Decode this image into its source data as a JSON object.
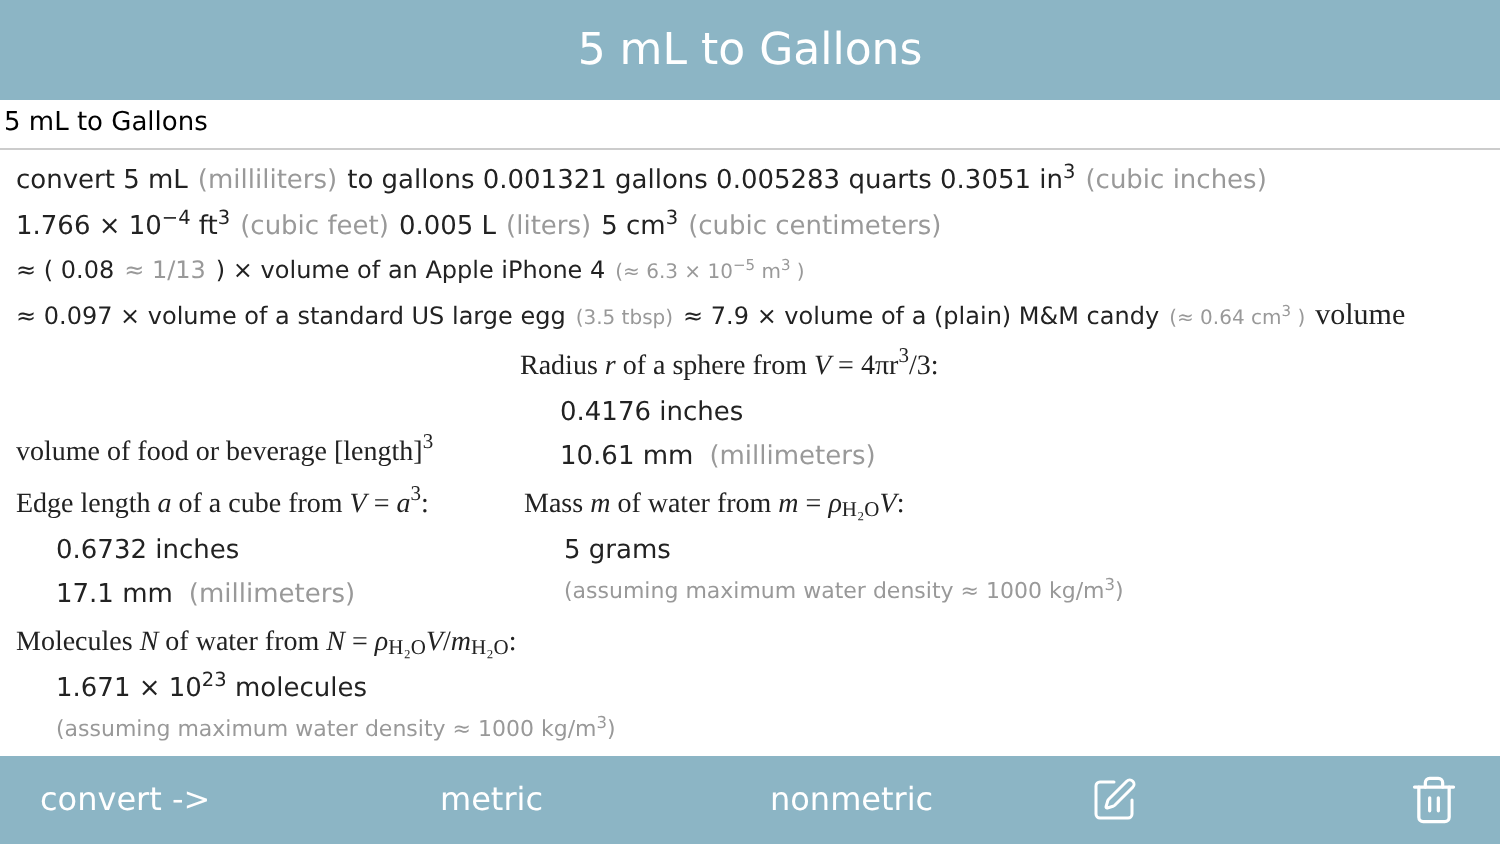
{
  "title": "5 mL to Gallons",
  "query": "5 mL to Gallons",
  "lines": [
    {
      "kind": "large",
      "segments": [
        {
          "kind": "value",
          "text": "convert 5 mL"
        },
        {
          "kind": "note",
          "text": "(milliliters)"
        },
        {
          "kind": "value",
          "text": "to gallons 0.001321 gallons 0.005283 quarts 0.3051 in$^{3}$"
        },
        {
          "kind": "note",
          "text": "(cubic inches)"
        }
      ]
    },
    {
      "kind": "large",
      "segments": [
        {
          "kind": "value",
          "text": "1.766 × 10$^{−4}$ ft$^{3}$"
        },
        {
          "kind": "note",
          "text": "(cubic feet)"
        },
        {
          "kind": "value",
          "text": "0.005 L"
        },
        {
          "kind": "note",
          "text": "(liters)"
        },
        {
          "kind": "value",
          "text": "5 cm$^{3}$"
        },
        {
          "kind": "note",
          "text": "(cubic centimeters)"
        }
      ]
    },
    {
      "kind": "small",
      "segments": [
        {
          "kind": "value",
          "text": "≈ ( 0.08"
        },
        {
          "kind": "note",
          "text": "≈ 1/13"
        },
        {
          "kind": "value",
          "text": ") × volume of an Apple iPhone 4"
        },
        {
          "kind": "tiny",
          "text": "(≈ 6.3 × 10$^{−5}$ m$^{3}$ )"
        }
      ]
    },
    {
      "kind": "small",
      "segments": [
        {
          "kind": "value",
          "text": "≈ 0.097 × volume of a standard US large egg"
        },
        {
          "kind": "tiny",
          "text": "(3.5 tbsp)"
        },
        {
          "kind": "value",
          "text": "≈ 7.9 × volume of a (plain) M&M candy"
        },
        {
          "kind": "tiny",
          "text": "(≈ 0.64 cm$^{3}$ )"
        },
        {
          "kind": "math",
          "text": "volume"
        }
      ]
    }
  ],
  "food_label": "volume of food or beverage [length]$^{3}$",
  "radius": {
    "heading": "Radius *r* of a sphere from *V* = 4πr$^{3}$/3:",
    "values": [
      {
        "value": "0.4176 inches"
      },
      {
        "value": "10.61 mm",
        "note": "(millimeters)"
      }
    ]
  },
  "edge": {
    "heading": "Edge length *a* of a cube from *V* = *a*$^{3}$:",
    "values": [
      {
        "value": "0.6732 inches"
      },
      {
        "value": "17.1 mm",
        "note": "(millimeters)"
      }
    ]
  },
  "mass": {
    "heading": "Mass *m* of water from *m* = *ρ*$_{H₂O}$*V*:",
    "values": [
      {
        "value": "5 grams"
      },
      {
        "note": "(assuming maximum water density ≈ 1000 kg/m$^{3}$)"
      }
    ]
  },
  "molecules": {
    "heading": "Molecules *N* of water from *N* = *ρ*$_{H₂O}$*V*/*m*$_{H₂O}$:",
    "values": [
      {
        "value": "1.671 × 10$^{23}$ molecules"
      },
      {
        "note": "(assuming maximum water density ≈ 1000 kg/m$^{3}$)"
      }
    ]
  },
  "toolbar": [
    {
      "kind": "text",
      "label": "convert ->"
    },
    {
      "kind": "text",
      "label": "metric"
    },
    {
      "kind": "text",
      "label": "nonmetric"
    },
    {
      "kind": "edit"
    },
    {
      "kind": "trash"
    }
  ]
}
